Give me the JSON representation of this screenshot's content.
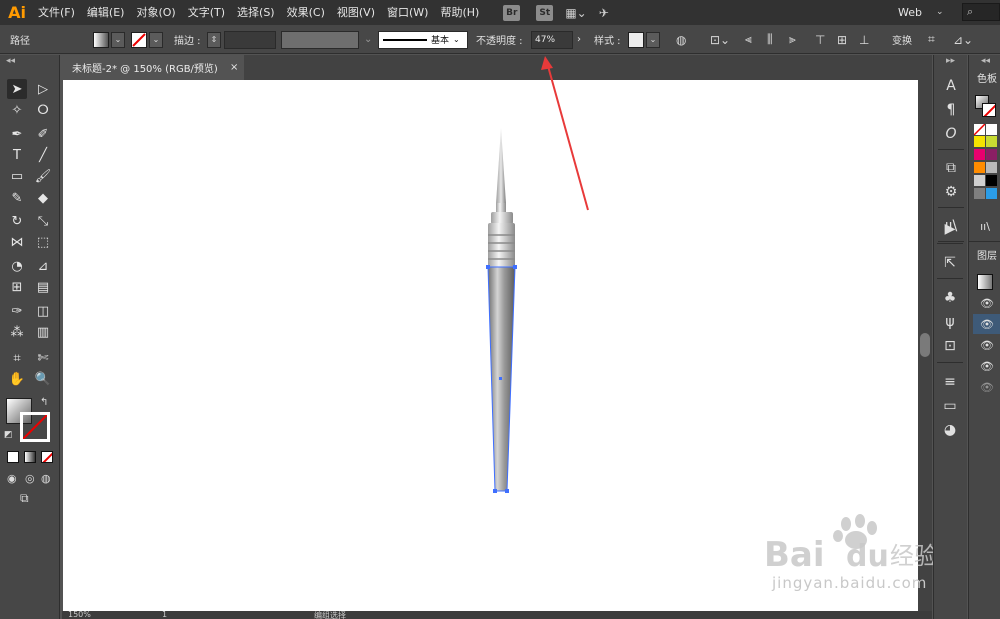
{
  "app": {
    "logo": "Ai",
    "document_tab": "未标题-2* @ 150% (RGB/预览)",
    "tab_close": "×"
  },
  "menubar": {
    "items": [
      "文件(F)",
      "编辑(E)",
      "对象(O)",
      "文字(T)",
      "选择(S)",
      "效果(C)",
      "视图(V)",
      "窗口(W)",
      "帮助(H)"
    ],
    "bridge": "Br",
    "stock": "St",
    "workspace": "Web",
    "workspace_arrow": "⌄",
    "search_icon": "⌕"
  },
  "controlbar": {
    "selection_label": "路径",
    "stroke_label": "描边 :",
    "brush_label": "基本",
    "opacity_label": "不透明度 :",
    "opacity_value": "47%",
    "style_label": "样式 :",
    "transform_label": "变换"
  },
  "status": {
    "zoom": "150%",
    "page": "1",
    "mode": "编组选择"
  },
  "panels": {
    "color_title": "色板",
    "layers_title": "图层"
  },
  "watermark": {
    "text": "Bai du 经验",
    "url": "jingyan.baidu.com"
  },
  "colors": {
    "arrow": "#e83a3a",
    "selection": "#3f6fff",
    "app_logo": "#ff9a00",
    "swatches": [
      "#ffffff",
      "#ffffff",
      "#f5e200",
      "#c8dc32",
      "#e8006e",
      "#8a1f64",
      "#ff8c00",
      "#b9b9b9",
      "#d0d0d0",
      "#000000",
      "#7f7f7f",
      "#2b9de8"
    ]
  },
  "icons": {
    "tools": [
      "selection-icon",
      "direct-selection-icon",
      "magic-wand-icon",
      "lasso-icon",
      "pen-icon",
      "curvature-icon",
      "type-icon",
      "line-icon",
      "rectangle-icon",
      "paintbrush-icon",
      "pencil-icon",
      "eraser-icon",
      "rotate-icon",
      "scale-icon",
      "width-icon",
      "free-transform-icon",
      "shape-builder-icon",
      "perspective-icon",
      "mesh-icon",
      "gradient-icon",
      "eyedropper-icon",
      "blend-icon",
      "symbol-sprayer-icon",
      "column-graph-icon",
      "artboard-icon",
      "slice-icon",
      "hand-icon",
      "zoom-icon"
    ]
  }
}
